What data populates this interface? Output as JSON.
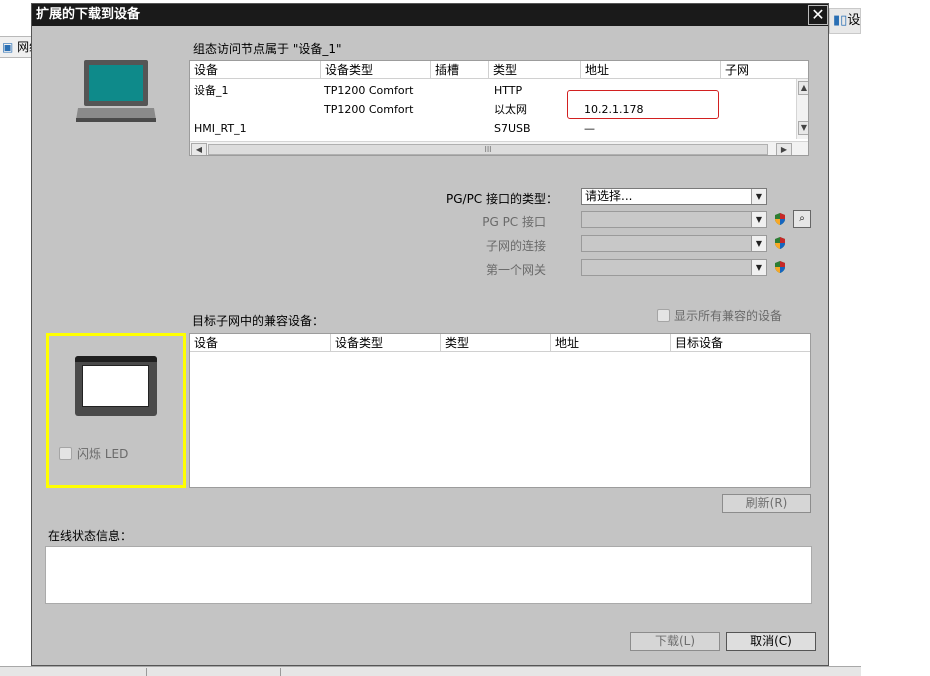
{
  "background": {
    "left_tab_label": "网络",
    "right_tab_label": "设"
  },
  "dialog": {
    "title": "扩展的下载到设备",
    "close_glyph": "✕",
    "config_caption": "组态访问节点属于 \"设备_1\"",
    "top_table": {
      "columns": [
        "设备",
        "设备类型",
        "插槽",
        "类型",
        "地址",
        "子网"
      ],
      "rows": [
        {
          "device": "设备_1",
          "device_type": "TP1200 Comfort",
          "slot": "",
          "type": "HTTP",
          "address": "",
          "subnet": ""
        },
        {
          "device": "",
          "device_type": "TP1200 Comfort",
          "slot": "",
          "type": "以太网",
          "address": "10.2.1.178",
          "subnet": ""
        },
        {
          "device": "HMI_RT_1",
          "device_type": "",
          "slot": "",
          "type": "S7USB",
          "address": "—",
          "subnet": ""
        }
      ],
      "hscroll_mark": "III"
    },
    "form": {
      "pgpc_type_label": "PG/PC 接口的类型：",
      "pgpc_type_value": "请选择...",
      "pgpc_iface_label": "PG PC 接口",
      "subnet_conn_label": "子网的连接",
      "first_gateway_label": "第一个网关"
    },
    "compatible_caption": "目标子网中的兼容设备：",
    "show_all_label": "显示所有兼容的设备",
    "flash_led_label": "闪烁 LED",
    "bottom_table": {
      "columns": [
        "设备",
        "设备类型",
        "类型",
        "地址",
        "目标设备"
      ]
    },
    "refresh_button": "刷新(R)",
    "status_caption": "在线状态信息：",
    "download_button": "下载(L)",
    "cancel_button": "取消(C)"
  },
  "colors": {
    "dialog_bg": "#c4c4c4",
    "titlebar": "#1a1a1a",
    "highlight_box": "#ffff00",
    "address_box": "#d22020"
  }
}
